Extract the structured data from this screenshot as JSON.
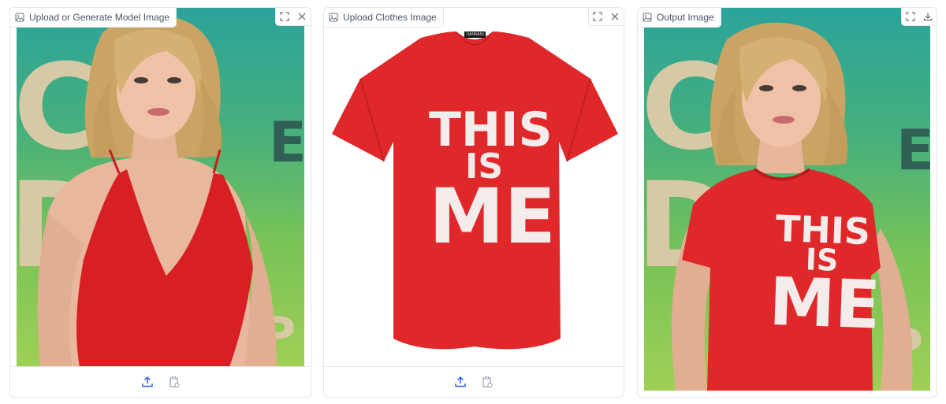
{
  "panels": [
    {
      "label": "Upload or Generate Model Image",
      "label_icon": "image-icon",
      "top_buttons": [
        "fullscreen-icon",
        "close-icon"
      ],
      "footer_buttons": [
        "upload-icon",
        "clipboard-icon"
      ]
    },
    {
      "label": "Upload Clothes Image",
      "label_icon": "image-icon",
      "top_buttons": [
        "fullscreen-icon",
        "close-icon"
      ],
      "footer_buttons": [
        "upload-icon",
        "clipboard-icon"
      ],
      "garment_print": {
        "line1": "THIS",
        "line2": "IS",
        "line3": "ME",
        "tag": "JIANNANI"
      }
    },
    {
      "label": "Output Image",
      "label_icon": "image-icon",
      "top_buttons": [
        "fullscreen-icon",
        "download-icon"
      ],
      "garment_print": {
        "line1": "THIS",
        "line2": "IS",
        "line3": "ME"
      }
    }
  ],
  "colors": {
    "garment_red": "#e0282a",
    "dress_red": "#d81f24",
    "backdrop_green": "#5fb56b",
    "print_white": "#f4ecea"
  }
}
